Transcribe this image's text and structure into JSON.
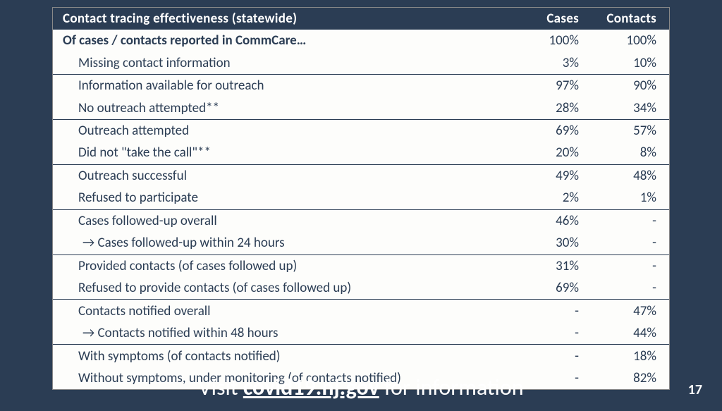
{
  "table": {
    "header": {
      "title": "Contact tracing effectiveness (statewide)",
      "col1": "Cases",
      "col2": "Contacts"
    },
    "rows": [
      {
        "label": "Of cases / contacts reported in CommCare…",
        "cases": "100%",
        "contacts": "100%",
        "first": true
      },
      {
        "label": "Missing contact information",
        "cases": "3%",
        "contacts": "10%",
        "indent": 1
      },
      {
        "label": "Information available for outreach",
        "cases": "97%",
        "contacts": "90%",
        "section": true,
        "indent": 1
      },
      {
        "label": "No outreach attempted**",
        "cases": "28%",
        "contacts": "34%",
        "indent": 1
      },
      {
        "label": "Outreach attempted",
        "cases": "69%",
        "contacts": "57%",
        "section": true,
        "indent": 1
      },
      {
        "label": "Did not \"take the call\"**",
        "cases": "20%",
        "contacts": "8%",
        "indent": 1
      },
      {
        "label": "Outreach successful",
        "cases": "49%",
        "contacts": "48%",
        "section": true,
        "indent": 1
      },
      {
        "label": "Refused to participate",
        "cases": "2%",
        "contacts": "1%",
        "indent": 1
      },
      {
        "label": "Cases followed-up overall",
        "cases": "46%",
        "contacts": "-",
        "section": true,
        "indent": 1
      },
      {
        "label": "→ Cases followed-up within 24 hours",
        "cases": "30%",
        "contacts": "-",
        "indent": 2
      },
      {
        "label": "Provided contacts (of cases followed up)",
        "cases": "31%",
        "contacts": "-",
        "section": true,
        "indent": 1
      },
      {
        "label": "Refused to provide contacts (of cases followed up)",
        "cases": "69%",
        "contacts": "-",
        "indent": 1
      },
      {
        "label": "Contacts notified overall",
        "cases": "-",
        "contacts": "47%",
        "section": true,
        "indent": 1
      },
      {
        "label": "→ Contacts notified within 48 hours",
        "cases": "-",
        "contacts": "44%",
        "indent": 2
      },
      {
        "label": "With symptoms (of contacts notified)",
        "cases": "-",
        "contacts": "18%",
        "section": true,
        "indent": 1
      },
      {
        "label": "Without symptoms, under monitoring (of contacts notified)",
        "cases": "-",
        "contacts": "82%",
        "indent": 1
      }
    ]
  },
  "footer": {
    "prefix": "Visit ",
    "link": "covid19.nj.gov",
    "suffix": "  for information"
  },
  "page_number": "17"
}
